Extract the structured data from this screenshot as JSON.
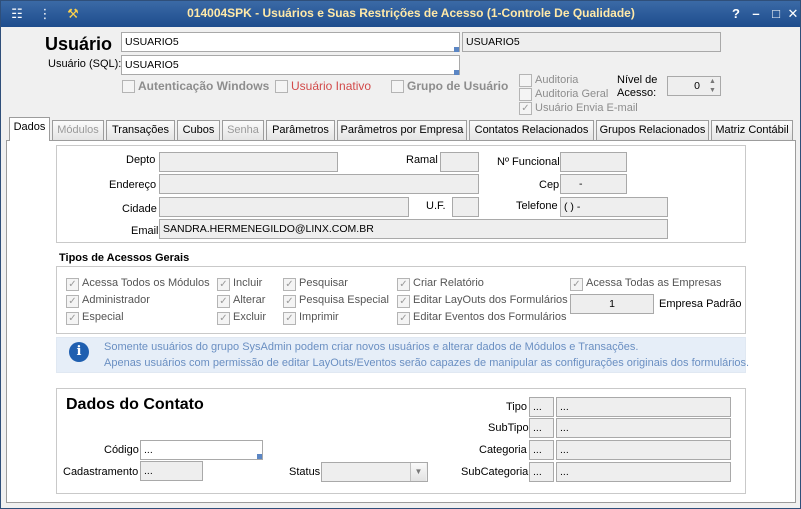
{
  "window": {
    "title": "014004SPK - Usuários e Suas Restrições de Acesso (1-Controle De Qualidade)"
  },
  "header": {
    "usuario_label": "Usuário",
    "usuario_value": "USUARIO5",
    "usuario_name_value": "USUARIO5",
    "usuario_sql_label": "Usuário (SQL):",
    "usuario_sql_value": "USUARIO5",
    "autenticacao_windows": "Autenticação Windows",
    "usuario_inativo": "Usuário Inativo",
    "grupo_de_usuario": "Grupo de Usuário",
    "auditoria": "Auditoria",
    "auditoria_geral": "Auditoria Geral",
    "usuario_envia_email": "Usuário Envia E-mail",
    "nivel_acesso_label": "Nível de Acesso:",
    "nivel_acesso_value": "0"
  },
  "tabs": [
    {
      "label": "Dados"
    },
    {
      "label": "Módulos"
    },
    {
      "label": "Transações"
    },
    {
      "label": "Cubos"
    },
    {
      "label": "Senha"
    },
    {
      "label": "Parâmetros"
    },
    {
      "label": "Parâmetros por Empresa"
    },
    {
      "label": "Contatos Relacionados"
    },
    {
      "label": "Grupos Relacionados"
    },
    {
      "label": "Matriz Contábil"
    }
  ],
  "dados": {
    "depto": "Depto",
    "ramal": "Ramal",
    "n_funcional": "Nº Funcional",
    "endereco": "Endereço",
    "cep": "Cep",
    "cep_value": "-",
    "cidade": "Cidade",
    "uf": "U.F.",
    "telefone": "Telefone",
    "telefone_value": "(  )    -",
    "email": "Email",
    "email_value": "SANDRA.HERMENEGILDO@LINX.COM.BR"
  },
  "acessos": {
    "title": "Tipos de Acessos Gerais",
    "col1": [
      "Acessa Todos os Módulos",
      "Administrador",
      "Especial"
    ],
    "col2": [
      "Incluir",
      "Alterar",
      "Excluir"
    ],
    "col3": [
      "Pesquisar",
      "Pesquisa Especial",
      "Imprimir"
    ],
    "col4": [
      "Criar Relatório",
      "Editar LayOuts dos Formulários",
      "Editar Eventos dos Formulários"
    ],
    "acessa_todas_empresas": "Acessa Todas as Empresas",
    "empresa_padrao_value": "1",
    "empresa_padrao_label": "Empresa Padrão"
  },
  "info": {
    "line1": "Somente usuários do grupo SysAdmin podem criar novos usuários e alterar dados de Módulos e Transações.",
    "line2": "Apenas usuários com permissão de editar LayOuts/Eventos serão capazes de manipular as configurações originais dos formulários."
  },
  "contato": {
    "title": "Dados do Contato",
    "codigo": "Código",
    "codigo_value": "...",
    "cadastramento": "Cadastramento",
    "cadastramento_value": "...",
    "status": "Status",
    "tipo": "Tipo",
    "subtipo": "SubTipo",
    "categoria": "Categoria",
    "subcategoria": "SubCategoria",
    "lookup_value": "..."
  }
}
